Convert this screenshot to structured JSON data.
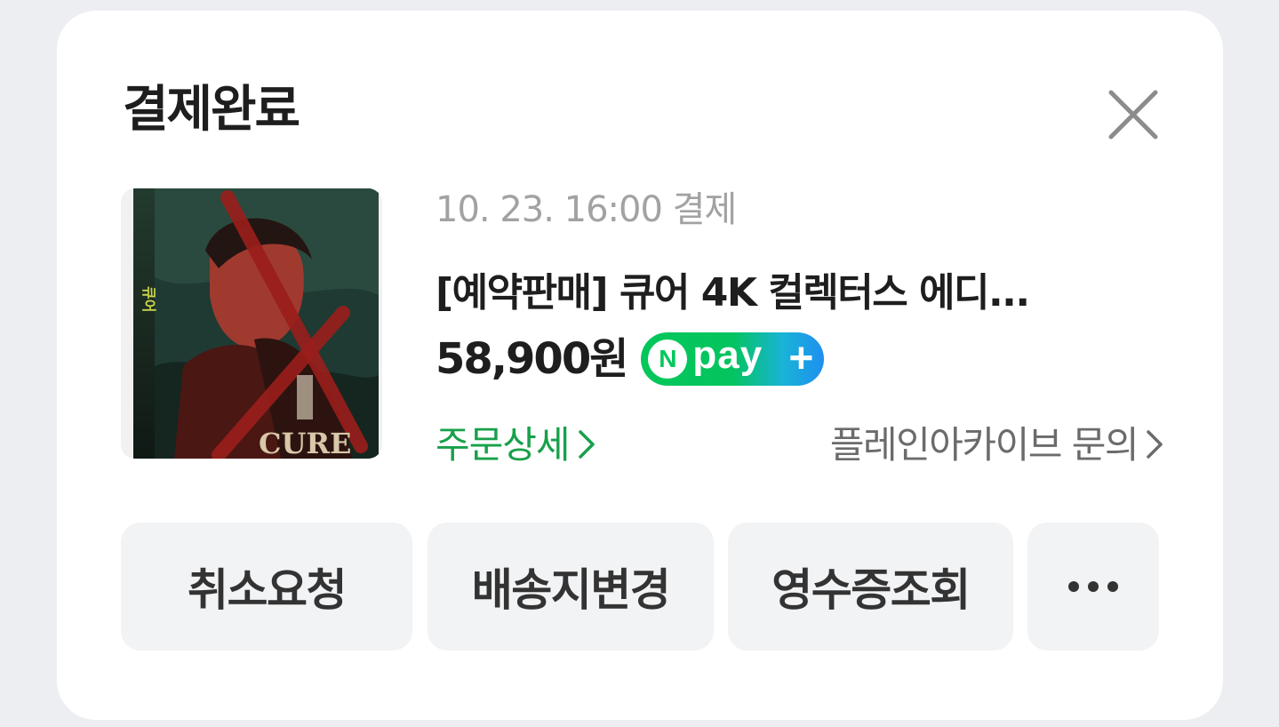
{
  "dialog": {
    "title": "결제완료",
    "close_icon": "close-icon"
  },
  "order": {
    "datetime": "10. 23. 16:00 결제",
    "product_name": "[예약판매] 큐어 4K 컬렉터스 에디...",
    "price": "58,900원",
    "thumbnail_text": "CURE",
    "thumbnail_side_text": "큐어",
    "pay_badge": {
      "n": "N",
      "label": "pay",
      "plus": "+"
    },
    "order_detail_link": "주문상세",
    "seller_inquiry_link": "플레인아카이브 문의",
    "accent_color": "#17a04a"
  },
  "actions": {
    "cancel_request": "취소요청",
    "change_address": "배송지변경",
    "receipt": "영수증조회",
    "more_icon": "more-dots-icon"
  }
}
